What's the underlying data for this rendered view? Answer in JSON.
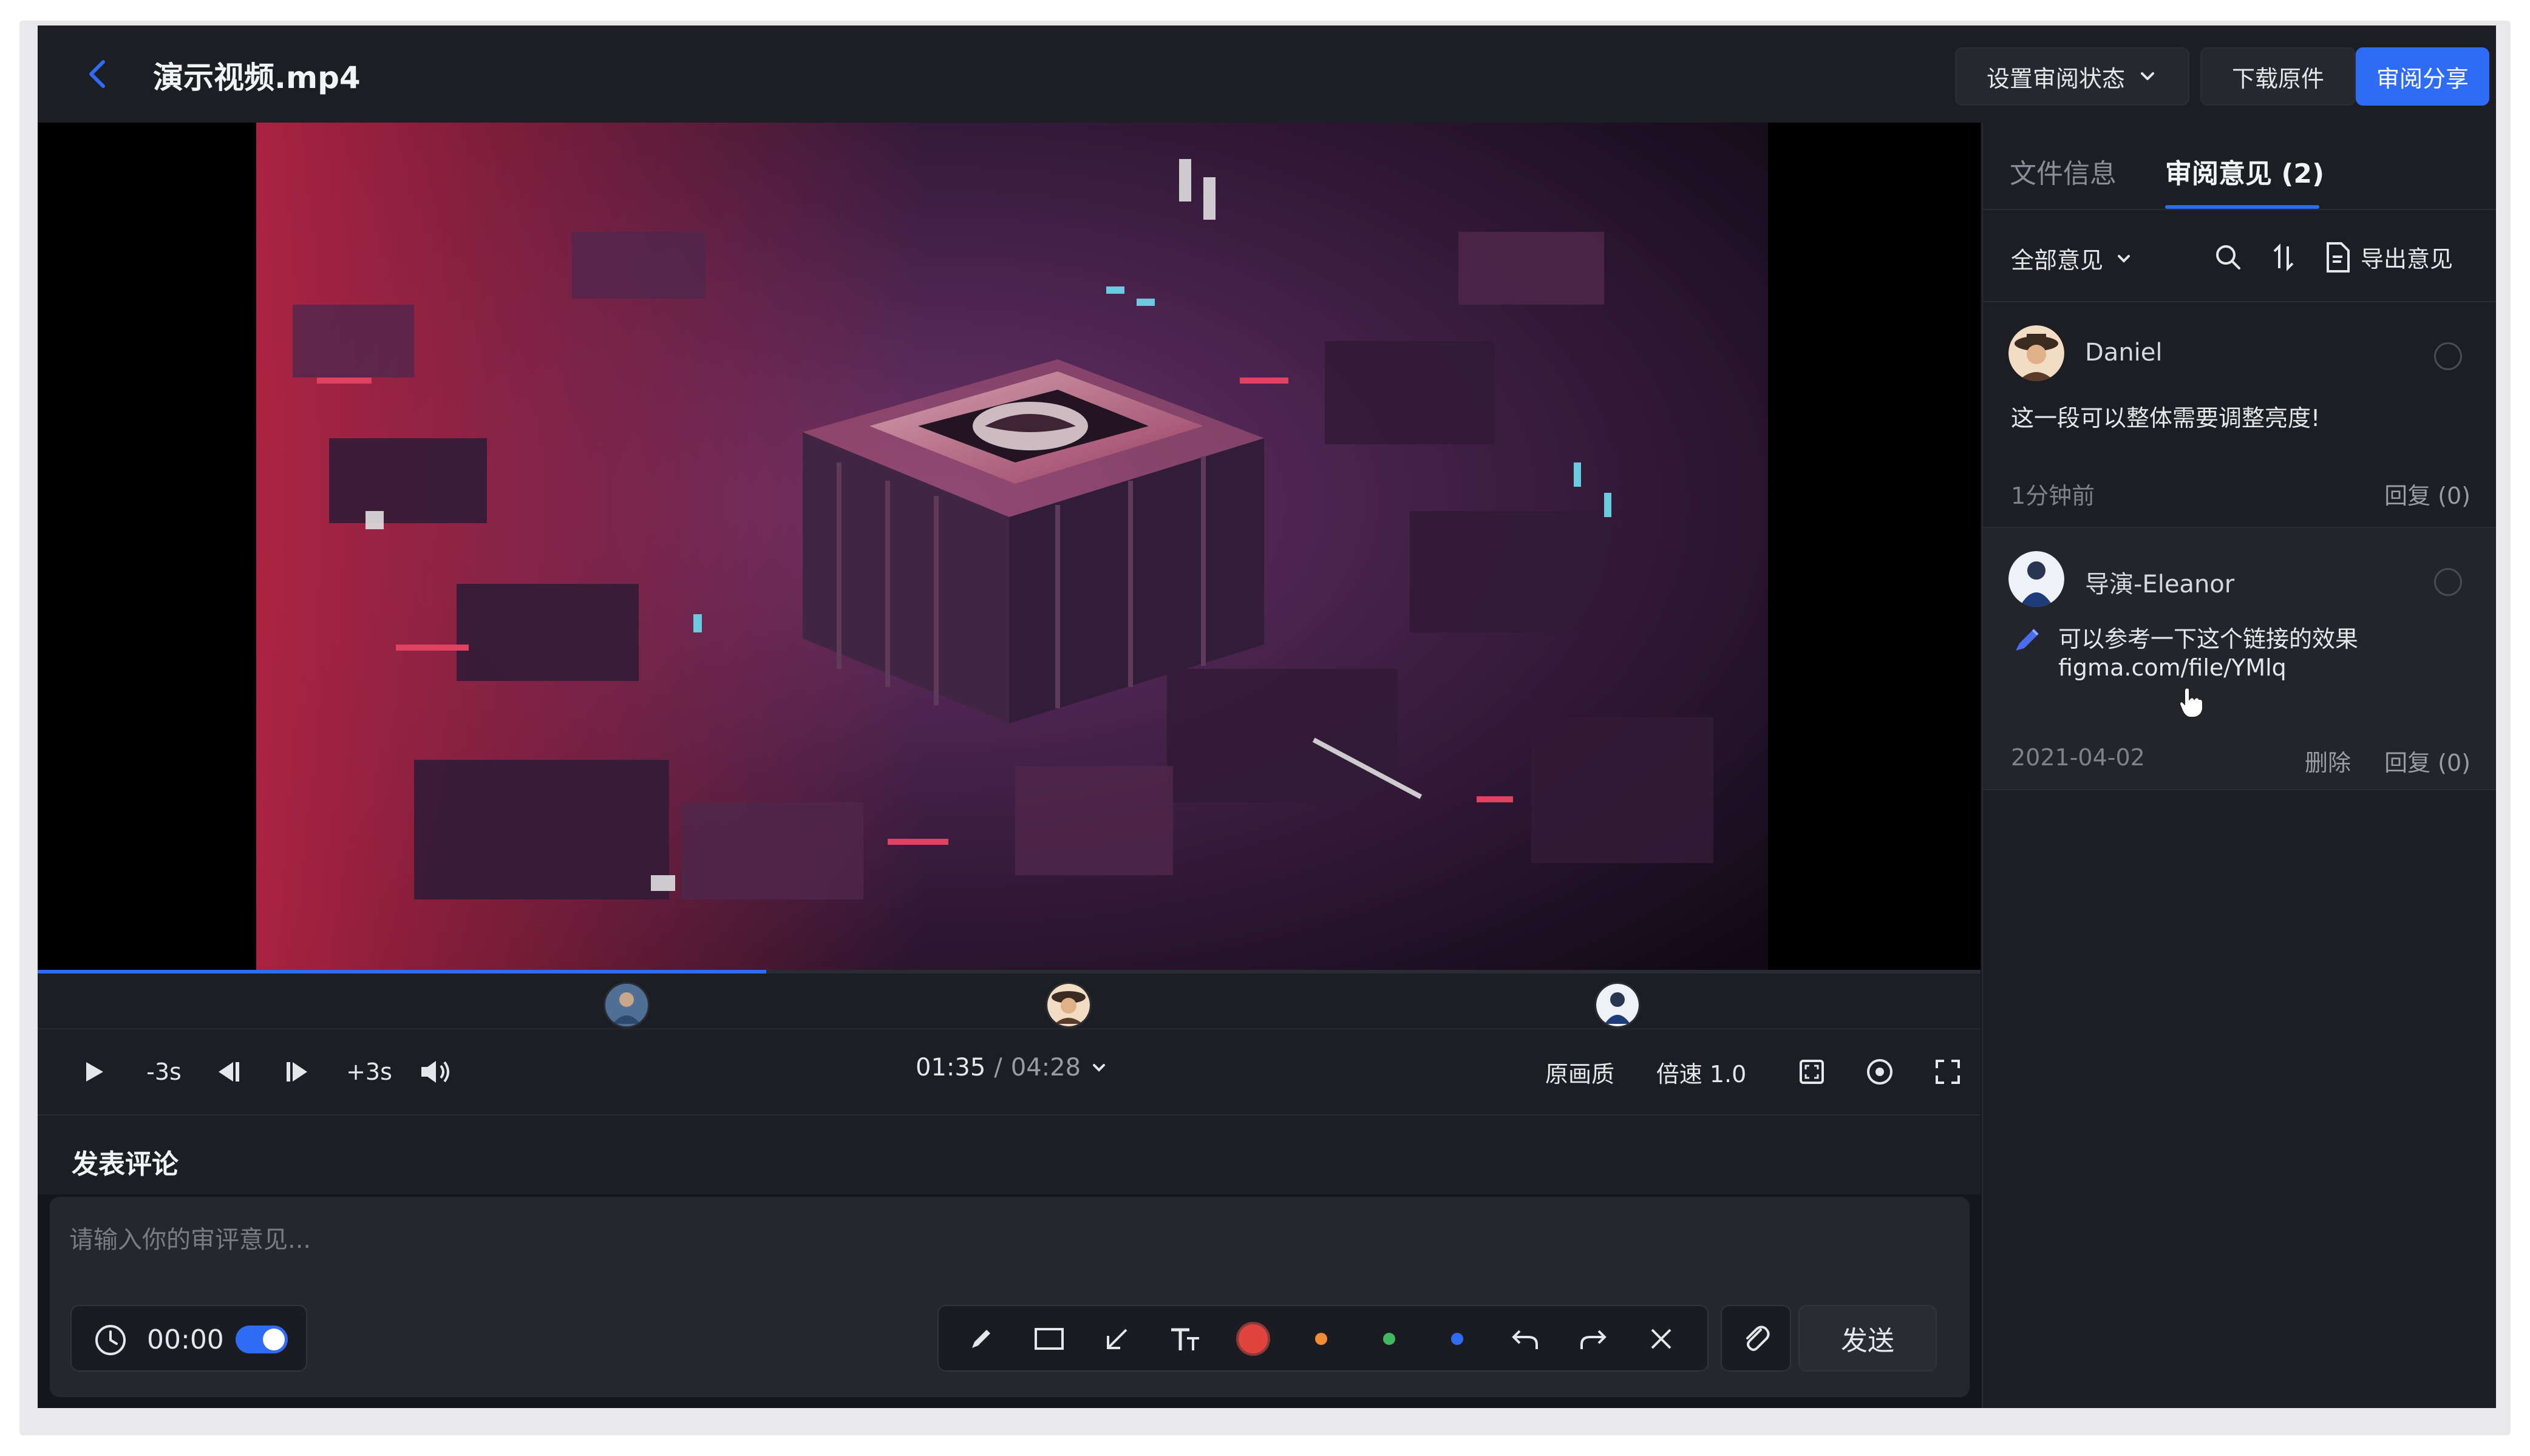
{
  "header": {
    "title": "演示视频.mp4",
    "set_status_label": "设置审阅状态",
    "download_label": "下载原件",
    "share_label": "审阅分享"
  },
  "player": {
    "rewind_label": "-3s",
    "forward_label": "+3s",
    "current_time": "01:35",
    "separator": "/",
    "total_time": "04:28",
    "quality_label": "原画质",
    "speed_label": "倍速 1.0",
    "progress_fraction": 0.375
  },
  "comment": {
    "section_title": "发表评论",
    "placeholder": "请输入你的审评意见...",
    "timestamp": "00:00",
    "timestamp_toggle_on": true,
    "send_label": "发送",
    "colors": [
      "#e0443c",
      "#ef8c34",
      "#3fb860",
      "#2f6cf6"
    ]
  },
  "sidebar": {
    "tabs": [
      "文件信息",
      "审阅意见 (2)"
    ],
    "active_tab": 1,
    "filter_label": "全部意见",
    "export_label": "导出意见",
    "comments": [
      {
        "author": "Daniel",
        "text": "这一段可以整体需要调整亮度!",
        "time": "1分钟前",
        "reply": "回复 (0)"
      },
      {
        "author": "导演-Eleanor",
        "text": "可以参考一下这个链接的效果",
        "link": "figma.com/file/YMlq",
        "time": "2021-04-02",
        "delete": "删除",
        "reply": "回复 (0)"
      }
    ]
  },
  "theme": {
    "accent": "#2f6cf6",
    "background": "#16171c",
    "panel": "#1d1e23"
  }
}
